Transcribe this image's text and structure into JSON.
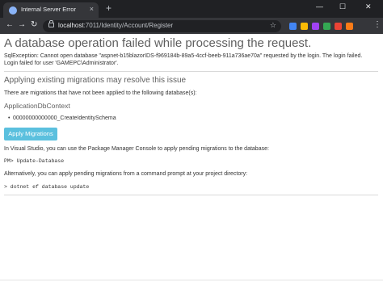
{
  "browser": {
    "tab_title": "Internal Server Error",
    "new_tab_symbol": "+",
    "tab_close_symbol": "×",
    "window_controls": {
      "minimize": "—",
      "maximize": "☐",
      "close": "✕"
    },
    "nav": {
      "back": "←",
      "forward": "→",
      "reload": "↻"
    },
    "url_host": "localhost",
    "url_path": ":7011/Identity/Account/Register",
    "star_symbol": "☆",
    "menu_symbol": "⋮",
    "extension_colors": [
      "#4285f4",
      "#fbbc05",
      "#a142f4",
      "#34a853",
      "#ea4335",
      "#fa7b17"
    ]
  },
  "page": {
    "title": "A database operation failed while processing the request.",
    "error_message": "SqlException: Cannot open database \"aspnet-b15blazorIDS-f969184b-89a5-4ccf-beeb-911a736ae70a\" requested by the login. The login failed. Login failed for user 'GAMEPC\\Administrator'.",
    "section_title": "Applying existing migrations may resolve this issue",
    "pending_text": "There are migrations that have not been applied to the following database(s):",
    "context_name": "ApplicationDbContext",
    "migrations": [
      "00000000000000_CreateIdentitySchema"
    ],
    "apply_button": "Apply Migrations",
    "vs_text": "In Visual Studio, you can use the Package Manager Console to apply pending migrations to the database:",
    "pmc_command": "PM> Update-Database",
    "cli_text": "Alternatively, you can apply pending migrations from a command prompt at your project directory:",
    "cli_command": "> dotnet ef database update"
  }
}
